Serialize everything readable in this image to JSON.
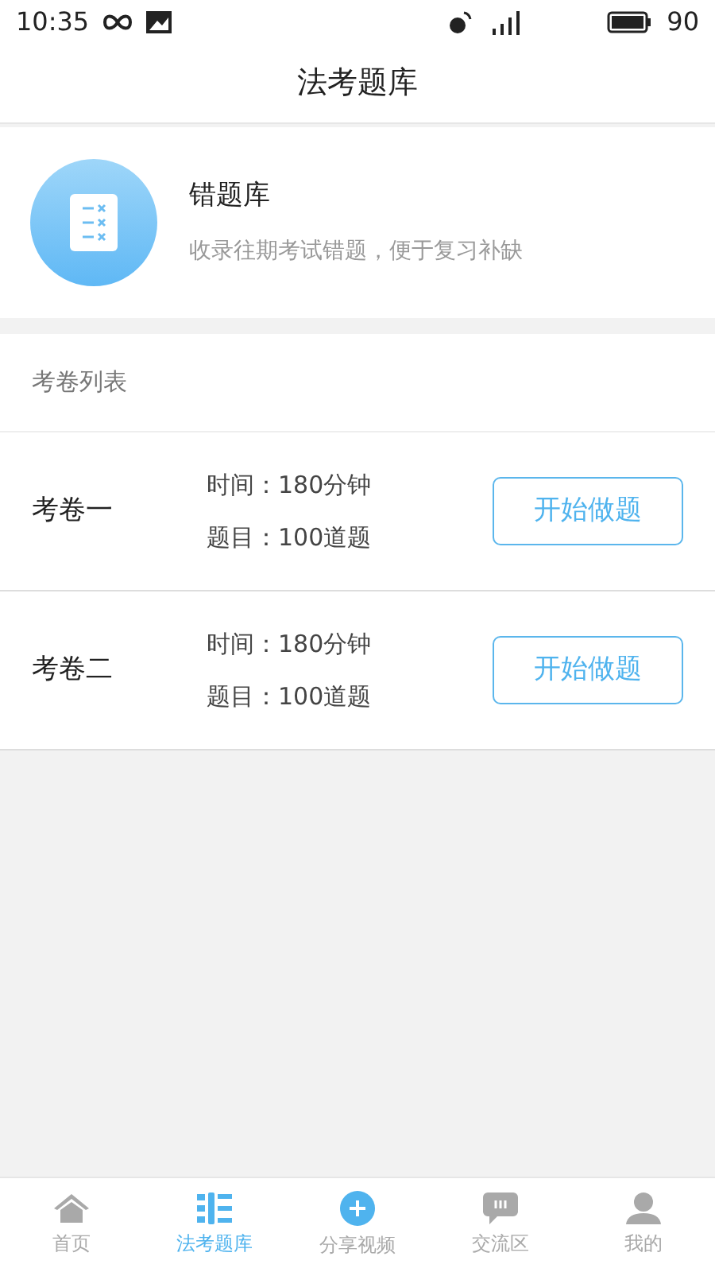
{
  "status_bar": {
    "time": "10:35",
    "battery": "90"
  },
  "header": {
    "title": "法考题库"
  },
  "wrong_bank": {
    "title": "错题库",
    "subtitle": "收录往期考试错题，便于复习补缺"
  },
  "section_title": "考卷列表",
  "papers": [
    {
      "name": "考卷一",
      "time": "时间：180分钟",
      "count": "题目：100道题",
      "button": "开始做题"
    },
    {
      "name": "考卷二",
      "time": "时间：180分钟",
      "count": "题目：100道题",
      "button": "开始做题"
    }
  ],
  "tabs": [
    {
      "kind": "home",
      "label": "首页",
      "selected": false
    },
    {
      "kind": "bank",
      "label": "法考题库",
      "selected": true
    },
    {
      "kind": "add",
      "label": "分享视频",
      "selected": false
    },
    {
      "kind": "chat",
      "label": "交流区",
      "selected": false
    },
    {
      "kind": "user",
      "label": "我的",
      "selected": false
    }
  ]
}
